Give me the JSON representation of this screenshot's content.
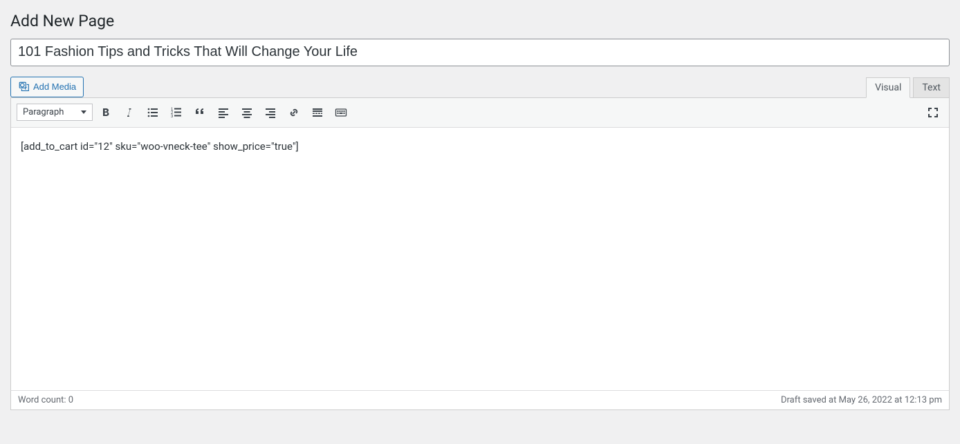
{
  "page": {
    "heading": "Add New Page",
    "title_value": "101 Fashion Tips and Tricks That Will Change Your Life"
  },
  "buttons": {
    "add_media": "Add Media"
  },
  "tabs": {
    "visual": "Visual",
    "text": "Text"
  },
  "toolbar": {
    "format_selected": "Paragraph"
  },
  "editor": {
    "content": "[add_to_cart id=\"12\" sku=\"woo-vneck-tee\" show_price=\"true\"]"
  },
  "status": {
    "word_count_label": "Word count: 0",
    "draft_saved": "Draft saved at May 26, 2022 at 12:13 pm"
  }
}
